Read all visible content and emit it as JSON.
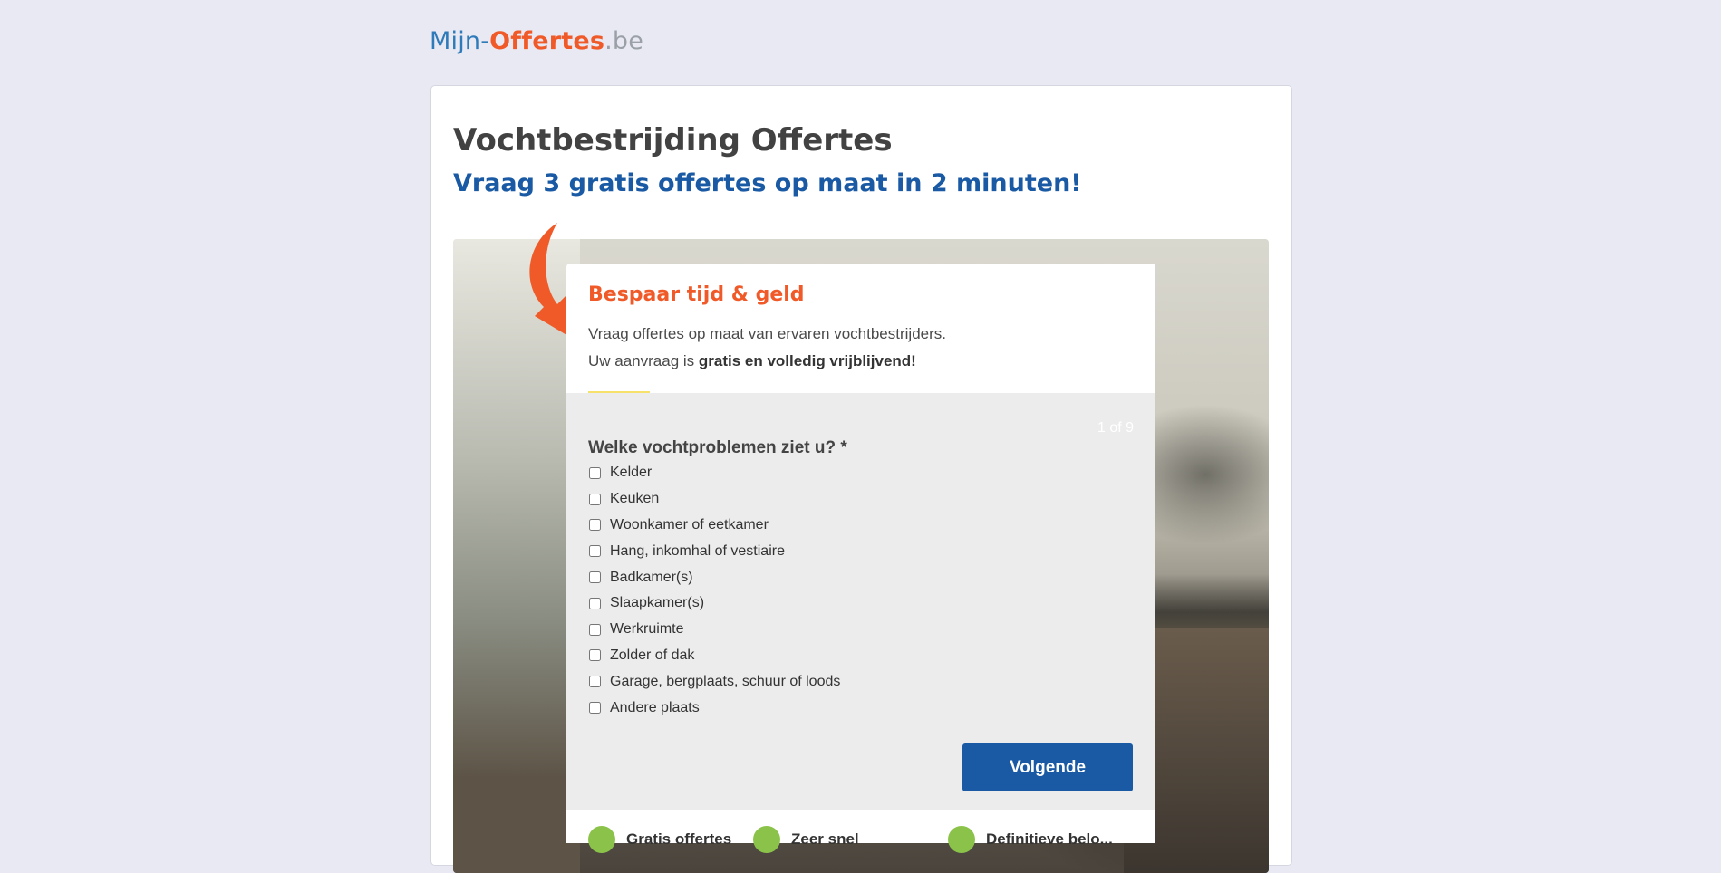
{
  "logo": {
    "part1": "Mijn-",
    "part2": "Offertes",
    "part3": ".be"
  },
  "page": {
    "title": "Vochtbestrijding Offertes",
    "subtitle": "Vraag 3 gratis offertes op maat in 2 minuten!"
  },
  "form": {
    "heading": "Bespaar tijd & geld",
    "line1": "Vraag offertes op maat van ervaren vochtbestrijders.",
    "line2_prefix": "Uw aanvraag is ",
    "line2_bold": "gratis en volledig vrijblijvend!",
    "step": "1 of 9",
    "progress_fraction": 0.111,
    "question": "Welke vochtproblemen ziet u? *",
    "options": [
      "Kelder",
      "Keuken",
      "Woonkamer of eetkamer",
      "Hang, inkomhal of vestiaire",
      "Badkamer(s)",
      "Slaapkamer(s)",
      "Werkruimte",
      "Zolder of dak",
      "Garage, bergplaats, schuur of loods",
      "Andere plaats"
    ],
    "next_label": "Volgende"
  },
  "badges": [
    "Gratis offertes",
    "Zeer snel",
    "Definitieve belo..."
  ],
  "colors": {
    "brand_blue": "#1a5aa4",
    "accent_orange": "#f05a28",
    "check_green": "#8bc34a",
    "progress_yellow": "#f7e16a"
  }
}
